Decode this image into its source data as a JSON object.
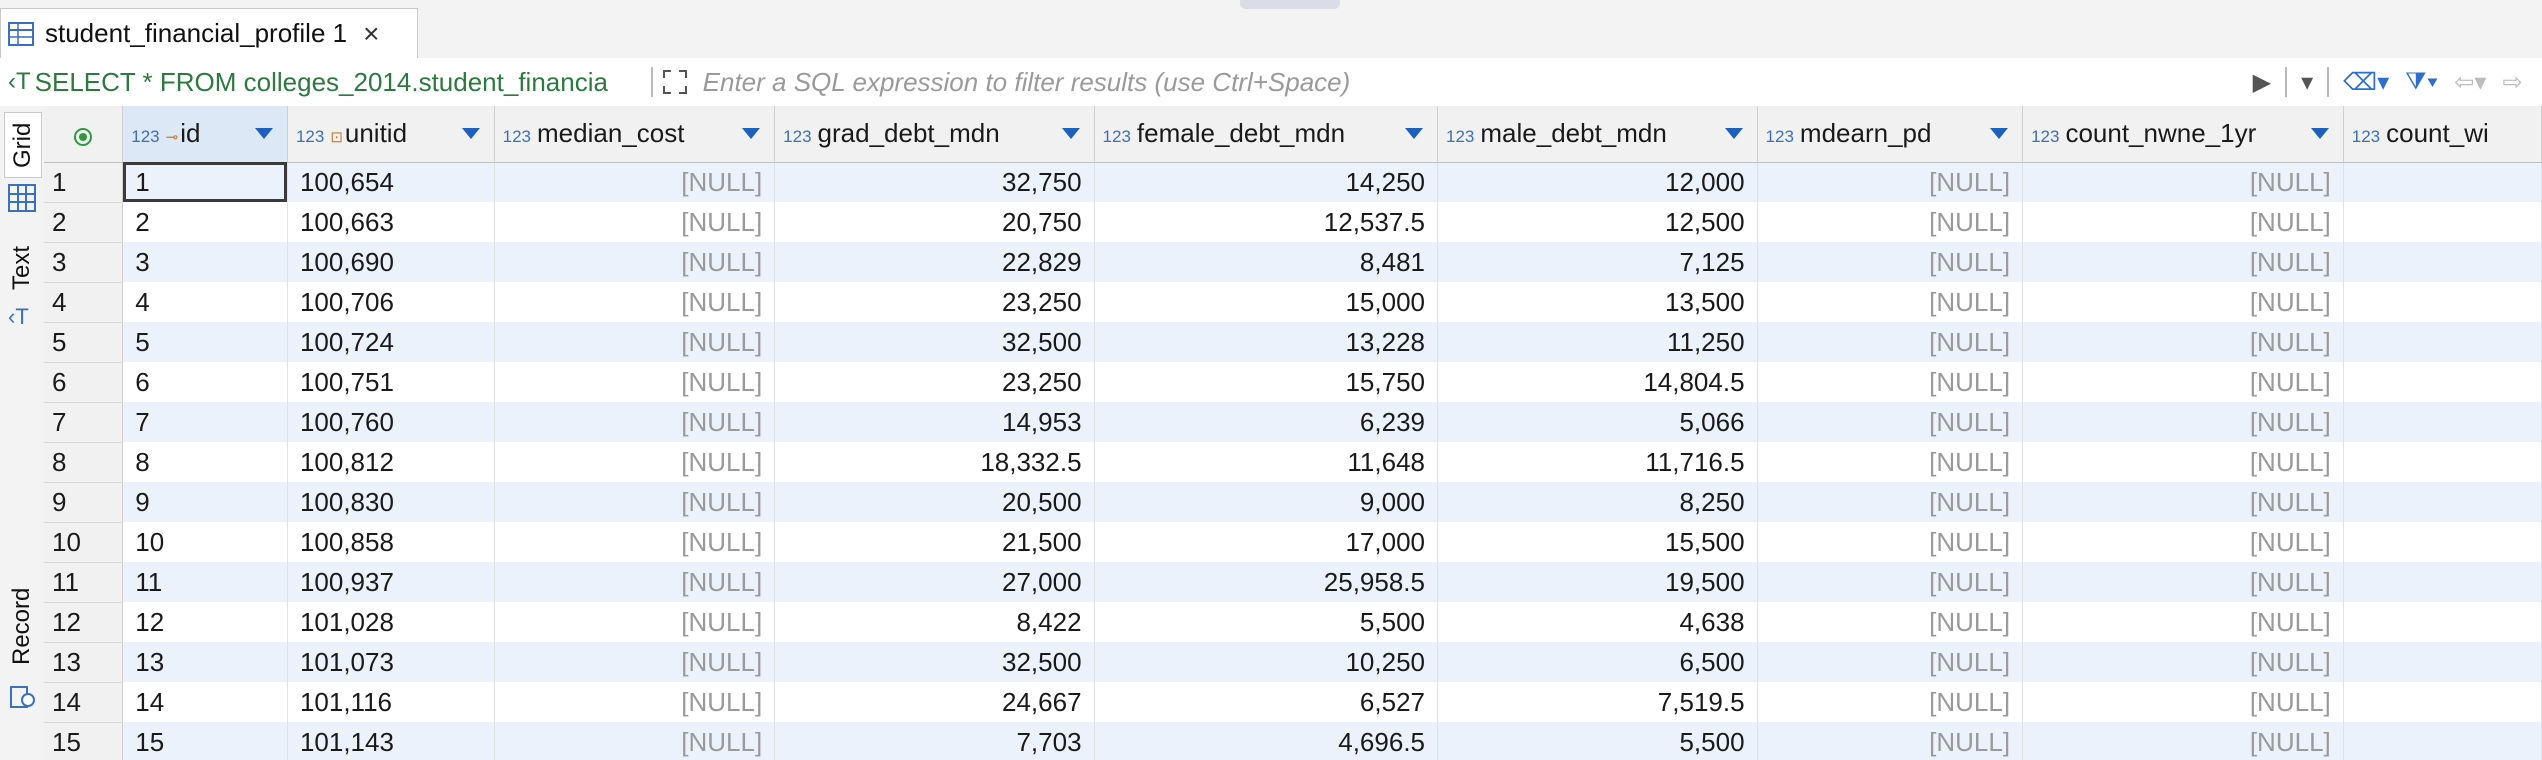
{
  "tab": {
    "title": "student_financial_profile 1",
    "close_glyph": "×"
  },
  "filterbar": {
    "sql": "SELECT * FROM colleges_2014.student_financia",
    "filter_placeholder": "Enter a SQL expression to filter results (use Ctrl+Space)"
  },
  "sidebar": {
    "tabs": [
      {
        "label": "Grid"
      },
      {
        "label": "Text"
      },
      {
        "label": "Record"
      }
    ]
  },
  "grid": {
    "type_prefix": "123",
    "columns": [
      {
        "name": "id"
      },
      {
        "name": "unitid"
      },
      {
        "name": "median_cost"
      },
      {
        "name": "grad_debt_mdn"
      },
      {
        "name": "female_debt_mdn"
      },
      {
        "name": "male_debt_mdn"
      },
      {
        "name": "mdearn_pd"
      },
      {
        "name": "count_nwne_1yr"
      },
      {
        "name": "count_wi"
      }
    ],
    "rows": [
      {
        "n": "1",
        "cells": [
          "1",
          "100,654",
          "[NULL]",
          "32,750",
          "14,250",
          "12,000",
          "[NULL]",
          "[NULL]",
          ""
        ]
      },
      {
        "n": "2",
        "cells": [
          "2",
          "100,663",
          "[NULL]",
          "20,750",
          "12,537.5",
          "12,500",
          "[NULL]",
          "[NULL]",
          ""
        ]
      },
      {
        "n": "3",
        "cells": [
          "3",
          "100,690",
          "[NULL]",
          "22,829",
          "8,481",
          "7,125",
          "[NULL]",
          "[NULL]",
          ""
        ]
      },
      {
        "n": "4",
        "cells": [
          "4",
          "100,706",
          "[NULL]",
          "23,250",
          "15,000",
          "13,500",
          "[NULL]",
          "[NULL]",
          ""
        ]
      },
      {
        "n": "5",
        "cells": [
          "5",
          "100,724",
          "[NULL]",
          "32,500",
          "13,228",
          "11,250",
          "[NULL]",
          "[NULL]",
          ""
        ]
      },
      {
        "n": "6",
        "cells": [
          "6",
          "100,751",
          "[NULL]",
          "23,250",
          "15,750",
          "14,804.5",
          "[NULL]",
          "[NULL]",
          ""
        ]
      },
      {
        "n": "7",
        "cells": [
          "7",
          "100,760",
          "[NULL]",
          "14,953",
          "6,239",
          "5,066",
          "[NULL]",
          "[NULL]",
          ""
        ]
      },
      {
        "n": "8",
        "cells": [
          "8",
          "100,812",
          "[NULL]",
          "18,332.5",
          "11,648",
          "11,716.5",
          "[NULL]",
          "[NULL]",
          ""
        ]
      },
      {
        "n": "9",
        "cells": [
          "9",
          "100,830",
          "[NULL]",
          "20,500",
          "9,000",
          "8,250",
          "[NULL]",
          "[NULL]",
          ""
        ]
      },
      {
        "n": "10",
        "cells": [
          "10",
          "100,858",
          "[NULL]",
          "21,500",
          "17,000",
          "15,500",
          "[NULL]",
          "[NULL]",
          ""
        ]
      },
      {
        "n": "11",
        "cells": [
          "11",
          "100,937",
          "[NULL]",
          "27,000",
          "25,958.5",
          "19,500",
          "[NULL]",
          "[NULL]",
          ""
        ]
      },
      {
        "n": "12",
        "cells": [
          "12",
          "101,028",
          "[NULL]",
          "8,422",
          "5,500",
          "4,638",
          "[NULL]",
          "[NULL]",
          ""
        ]
      },
      {
        "n": "13",
        "cells": [
          "13",
          "101,073",
          "[NULL]",
          "32,500",
          "10,250",
          "6,500",
          "[NULL]",
          "[NULL]",
          ""
        ]
      },
      {
        "n": "14",
        "cells": [
          "14",
          "101,116",
          "[NULL]",
          "24,667",
          "6,527",
          "7,519.5",
          "[NULL]",
          "[NULL]",
          ""
        ]
      },
      {
        "n": "15",
        "cells": [
          "15",
          "101,143",
          "[NULL]",
          "7,703",
          "4,696.5",
          "5,500",
          "[NULL]",
          "[NULL]",
          ""
        ]
      }
    ]
  }
}
